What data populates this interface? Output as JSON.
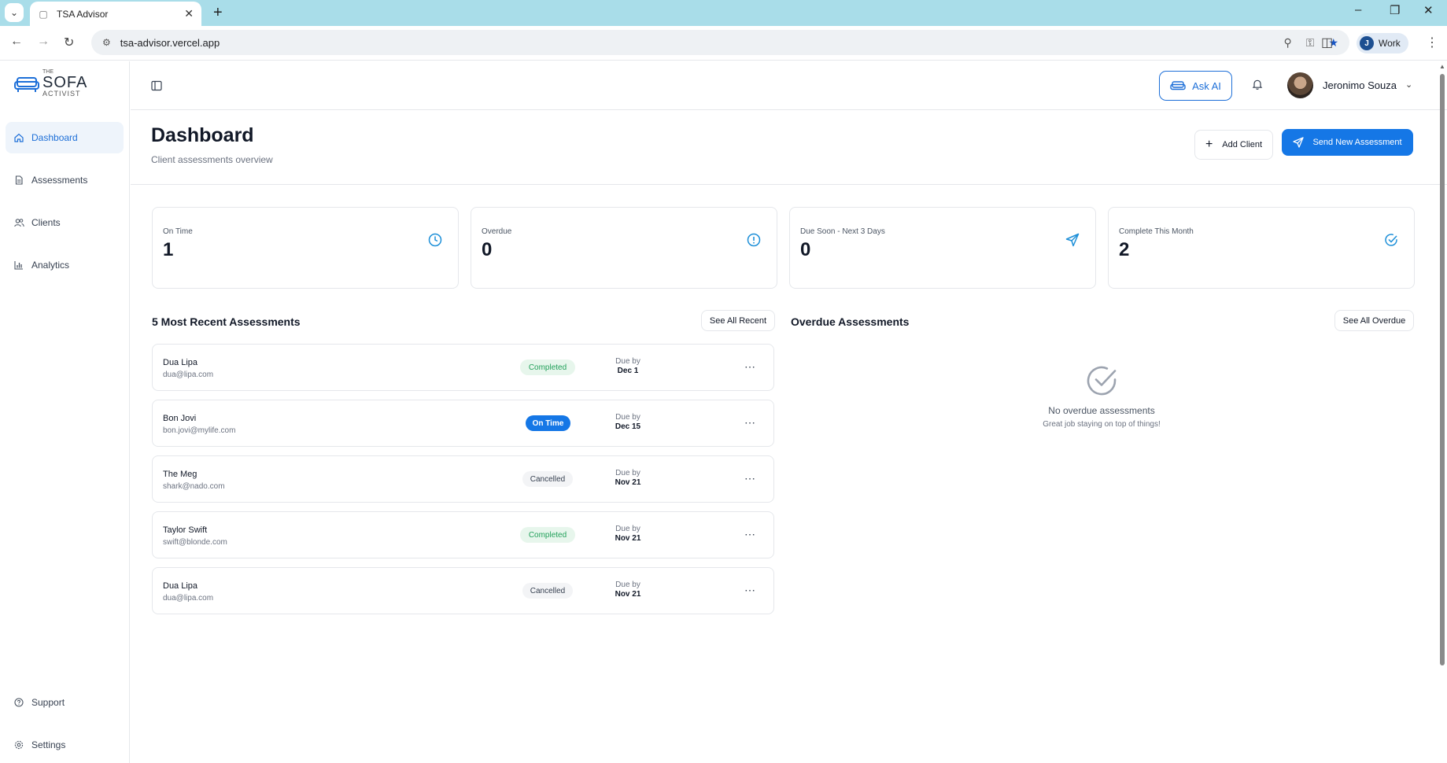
{
  "browser": {
    "tab_title": "TSA Advisor",
    "url": "tsa-advisor.vercel.app",
    "profile_initial": "J",
    "profile_label": "Work"
  },
  "sidebar": {
    "logo": {
      "the": "THE",
      "sofa": "SOFA",
      "activist": "ACTIVIST"
    },
    "items": [
      {
        "label": "Dashboard",
        "icon": "home-icon",
        "active": true
      },
      {
        "label": "Assessments",
        "icon": "document-icon",
        "active": false
      },
      {
        "label": "Clients",
        "icon": "users-icon",
        "active": false
      },
      {
        "label": "Analytics",
        "icon": "bar-chart-icon",
        "active": false
      }
    ],
    "bottom": [
      {
        "label": "Support",
        "icon": "help-circle-icon"
      },
      {
        "label": "Settings",
        "icon": "gear-icon"
      }
    ]
  },
  "topbar": {
    "ask_ai": "Ask AI",
    "user_name": "Jeronimo Souza"
  },
  "header": {
    "title": "Dashboard",
    "subtitle": "Client assessments overview",
    "add_client": "Add Client",
    "send_assessment": "Send New Assessment"
  },
  "stats": [
    {
      "label": "On Time",
      "value": "1",
      "icon": "clock-icon"
    },
    {
      "label": "Overdue",
      "value": "0",
      "icon": "alert-circle-icon"
    },
    {
      "label": "Due Soon - Next 3 Days",
      "value": "0",
      "icon": "send-icon"
    },
    {
      "label": "Complete This Month",
      "value": "2",
      "icon": "check-circle-icon"
    }
  ],
  "recent": {
    "title": "5 Most Recent Assessments",
    "see_all": "See All Recent",
    "due_label": "Due by",
    "rows": [
      {
        "name": "Dua Lipa",
        "email": "dua@lipa.com",
        "status": "Completed",
        "status_kind": "completed",
        "due": "Dec 1"
      },
      {
        "name": "Bon Jovi",
        "email": "bon.jovi@mylife.com",
        "status": "On Time",
        "status_kind": "ontime",
        "due": "Dec 15"
      },
      {
        "name": "The Meg",
        "email": "shark@nado.com",
        "status": "Cancelled",
        "status_kind": "cancelled",
        "due": "Nov 21"
      },
      {
        "name": "Taylor Swift",
        "email": "swift@blonde.com",
        "status": "Completed",
        "status_kind": "completed",
        "due": "Nov 21"
      },
      {
        "name": "Dua Lipa",
        "email": "dua@lipa.com",
        "status": "Cancelled",
        "status_kind": "cancelled",
        "due": "Nov 21"
      }
    ]
  },
  "overdue": {
    "title": "Overdue Assessments",
    "see_all": "See All Overdue",
    "empty_title": "No overdue assessments",
    "empty_sub": "Great job staying on top of things!"
  },
  "colors": {
    "accent": "#1577e6",
    "completed": "#22a05a",
    "sidebar_active_bg": "#eef4fb"
  }
}
